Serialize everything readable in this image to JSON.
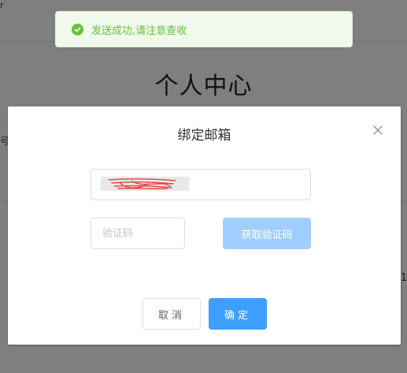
{
  "background": {
    "page_title": "个人中心",
    "left_fragment": "号",
    "right_fragment": "1",
    "corner_fragment": "r"
  },
  "toast": {
    "icon": "check-circle-icon",
    "message": "发送成功,请注意查收",
    "color": "#67c23a"
  },
  "dialog": {
    "title": "绑定邮箱",
    "close_icon": "close-icon",
    "email_value": "",
    "code_placeholder": "验证码",
    "get_code_label": "获取验证码",
    "cancel_label": "取消",
    "confirm_label": "确定"
  },
  "colors": {
    "primary": "#409eff",
    "primary_disabled": "#a0cfff",
    "success": "#67c23a"
  }
}
